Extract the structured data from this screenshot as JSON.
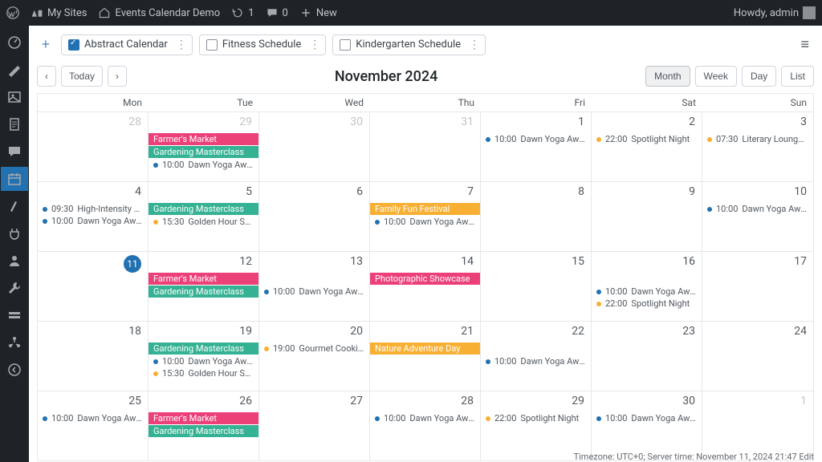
{
  "adminbar": {
    "my_sites": "My Sites",
    "site_name": "Events Calendar Demo",
    "refresh_count": "1",
    "comments_count": "0",
    "new": "New",
    "howdy": "Howdy, admin"
  },
  "filters": [
    {
      "label": "Abstract Calendar",
      "checked": true
    },
    {
      "label": "Fitness Schedule",
      "checked": false
    },
    {
      "label": "Kindergarten Schedule",
      "checked": false
    }
  ],
  "nav": {
    "today": "Today"
  },
  "title": "November 2024",
  "views": {
    "month": "Month",
    "week": "Week",
    "day": "Day",
    "list": "List",
    "active": "month"
  },
  "daysOfWeek": [
    "Mon",
    "Tue",
    "Wed",
    "Thu",
    "Fri",
    "Sat",
    "Sun"
  ],
  "colors": {
    "pink": "#ec4079",
    "green": "#35b293",
    "orange": "#f7b034",
    "blue": "#2271b1"
  },
  "weeks": [
    [
      {
        "num": "28",
        "other": true
      },
      {
        "num": "29",
        "other": true,
        "bars": [
          {
            "label": "Farmer's Market",
            "color": "pink",
            "span": 2
          },
          {
            "label": "Gardening Masterclass",
            "color": "green",
            "span": 1
          }
        ],
        "dots": [
          {
            "time": "10:00",
            "label": "Dawn Yoga Awakening",
            "color": "blue"
          }
        ]
      },
      {
        "num": "30",
        "other": true,
        "barSlots": 1
      },
      {
        "num": "31",
        "other": true
      },
      {
        "num": "1",
        "dots": [
          {
            "time": "10:00",
            "label": "Dawn Yoga Awakening",
            "color": "blue"
          }
        ]
      },
      {
        "num": "2",
        "dots": [
          {
            "time": "22:00",
            "label": "Spotlight Night",
            "color": "orange"
          }
        ]
      },
      {
        "num": "3",
        "dots": [
          {
            "time": "07:30",
            "label": "Literary Lounge Gatherin",
            "color": "orange"
          }
        ]
      }
    ],
    [
      {
        "num": "4",
        "dots": [
          {
            "time": "09:30",
            "label": "High-Intensity Fitness",
            "color": "blue"
          },
          {
            "time": "10:00",
            "label": "Dawn Yoga Awakening",
            "color": "blue"
          }
        ]
      },
      {
        "num": "5",
        "bars": [
          {
            "label": "Gardening Masterclass",
            "color": "green",
            "span": 1
          }
        ],
        "dots": [
          {
            "time": "15:30",
            "label": "Golden Hour Social Tea",
            "color": "orange"
          }
        ]
      },
      {
        "num": "6"
      },
      {
        "num": "7",
        "bars": [
          {
            "label": "Family Fun Festival",
            "color": "orange",
            "span": 3
          }
        ],
        "dots": [
          {
            "time": "10:00",
            "label": "Dawn Yoga Awakening",
            "color": "blue"
          }
        ]
      },
      {
        "num": "8",
        "barSlots": 1
      },
      {
        "num": "9",
        "barSlots": 1
      },
      {
        "num": "10",
        "dots": [
          {
            "time": "10:00",
            "label": "Dawn Yoga Awakening",
            "color": "blue"
          }
        ]
      }
    ],
    [
      {
        "num": "11",
        "today": true
      },
      {
        "num": "12",
        "bars": [
          {
            "label": "Farmer's Market",
            "color": "pink",
            "span": 2
          },
          {
            "label": "Gardening Masterclass",
            "color": "green",
            "span": 1
          }
        ]
      },
      {
        "num": "13",
        "barSlots": 1,
        "dots": [
          {
            "time": "10:00",
            "label": "Dawn Yoga Awakening",
            "color": "blue"
          }
        ]
      },
      {
        "num": "14",
        "bars": [
          {
            "label": "Photographic Showcase",
            "color": "pink",
            "span": 4
          }
        ]
      },
      {
        "num": "15",
        "barSlots": 1
      },
      {
        "num": "16",
        "barSlots": 1,
        "dots": [
          {
            "time": "10:00",
            "label": "Dawn Yoga Awakening",
            "color": "blue"
          },
          {
            "time": "22:00",
            "label": "Spotlight Night",
            "color": "orange"
          }
        ]
      },
      {
        "num": "17",
        "barSlots": 1
      }
    ],
    [
      {
        "num": "18"
      },
      {
        "num": "19",
        "bars": [
          {
            "label": "Gardening Masterclass",
            "color": "green",
            "span": 1
          }
        ],
        "dots": [
          {
            "time": "10:00",
            "label": "Dawn Yoga Awakening",
            "color": "blue"
          },
          {
            "time": "15:30",
            "label": "Golden Hour Social Tea",
            "color": "orange"
          }
        ]
      },
      {
        "num": "20",
        "dots": [
          {
            "time": "19:00",
            "label": "Gourmet Cooking Class",
            "color": "orange"
          }
        ]
      },
      {
        "num": "21",
        "bars": [
          {
            "label": "Nature Adventure Day",
            "color": "orange",
            "span": 2
          }
        ]
      },
      {
        "num": "22",
        "barSlots": 1,
        "dots": [
          {
            "time": "10:00",
            "label": "Dawn Yoga Awakening",
            "color": "blue"
          }
        ]
      },
      {
        "num": "23"
      },
      {
        "num": "24"
      }
    ],
    [
      {
        "num": "25",
        "dots": [
          {
            "time": "10:00",
            "label": "Dawn Yoga Awakening",
            "color": "blue"
          }
        ]
      },
      {
        "num": "26",
        "bars": [
          {
            "label": "Farmer's Market",
            "color": "pink",
            "span": 2
          },
          {
            "label": "Gardening Masterclass",
            "color": "green",
            "span": 1
          }
        ]
      },
      {
        "num": "27",
        "barSlots": 1
      },
      {
        "num": "28",
        "dots": [
          {
            "time": "10:00",
            "label": "Dawn Yoga Awakening",
            "color": "blue"
          }
        ]
      },
      {
        "num": "29",
        "dots": [
          {
            "time": "22:00",
            "label": "Spotlight Night",
            "color": "orange"
          }
        ]
      },
      {
        "num": "30",
        "dots": [
          {
            "time": "10:00",
            "label": "Dawn Yoga Awakening",
            "color": "blue"
          }
        ]
      },
      {
        "num": "1",
        "other": true
      }
    ]
  ],
  "footer": "Timezone: UTC+0; Server time: November 11, 2024 21:47 Edit"
}
